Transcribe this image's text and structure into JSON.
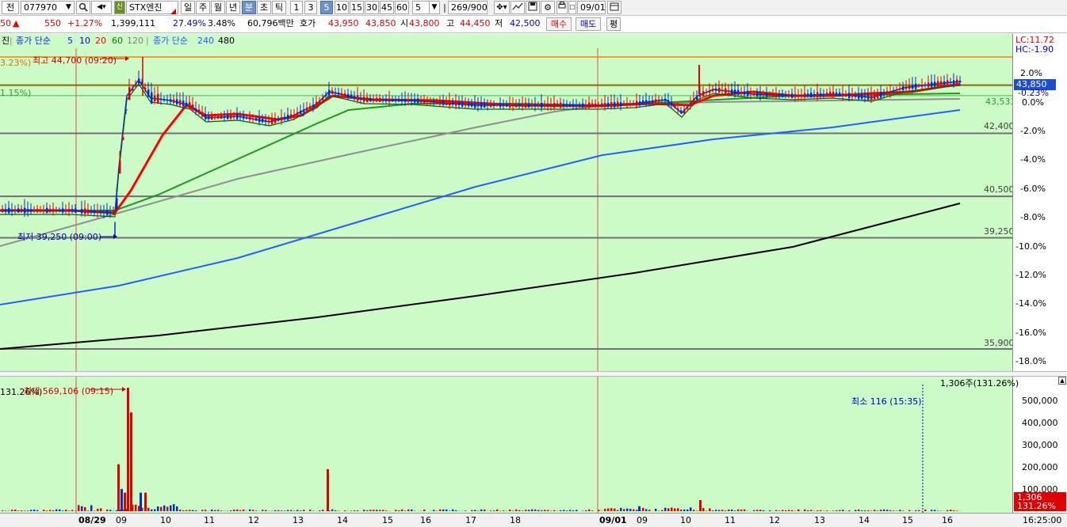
{
  "toolbar": {
    "market_label": "전",
    "code_value": "077970",
    "stock_badge": "신",
    "stock_name": "STX엔진",
    "periods": [
      "일",
      "주",
      "월",
      "년",
      "분",
      "초",
      "틱"
    ],
    "selected_period": "분",
    "intervals": [
      "1",
      "3",
      "5",
      "10",
      "15",
      "30",
      "45",
      "60"
    ],
    "selected_interval": "5",
    "interval_value": "5",
    "count_value": "269/900",
    "date_value": "09/01"
  },
  "info": {
    "price_tail": "50",
    "change_arrow": "▲",
    "change": "550",
    "change_pct": "+1.27%",
    "volume": "1,399,111",
    "vol_ratio": "27.49%",
    "turnover_pct": "3.48%",
    "amount": "60,796백만",
    "quote_label": "호가",
    "ask": "43,950",
    "bid": "43,850",
    "open_label": "시",
    "open": "43,800",
    "high_label": "고",
    "high": "44,450",
    "low_label": "저",
    "low": "42,500",
    "buy_label": "매수",
    "sell_label": "매도",
    "eval_label": "평"
  },
  "legend": {
    "tag": "진",
    "ma_label": "종가 단순",
    "ma_periods": [
      "5",
      "10",
      "20",
      "60",
      "120"
    ],
    "ma_colors": [
      "#1c1cff",
      "#0000cc",
      "#ff0000",
      "#008000",
      "#808080"
    ],
    "long_label": "종가 단순",
    "long_periods": [
      "240",
      "480"
    ],
    "long_colors": [
      "#1e5cff",
      "#000000"
    ]
  },
  "price_chart": {
    "top_left_pct": "3.23%)",
    "high_marker": "최고 44,700 (09:20)",
    "mid_left_pct": "1.15%)",
    "low_marker": "최저 39,250 (09:00)",
    "right_labels": {
      "current": "43,850",
      "ma_value": "43,533",
      "level1": "42,400",
      "level2": "40,500",
      "level3": "39,250",
      "level4": "35,900"
    },
    "axis_top": {
      "lc": "LC:11.72",
      "hc": "HC:-1.90"
    },
    "axis_pcts": [
      "2.0%",
      "-0.23%",
      "0.0%",
      "-2.0%",
      "-4.0%",
      "-6.0%",
      "-8.0%",
      "-10.0%",
      "-12.0%",
      "-14.0%",
      "-16.0%",
      "-18.0%"
    ],
    "current_pct": "-0.23%"
  },
  "volume_chart": {
    "left_pct": "131.26%)",
    "max_marker": "최대 569,106 (09:15)",
    "min_marker": "최소 116 (15:35)",
    "top_right": "1,306주(131.26%)",
    "axis_labels": [
      "500,000",
      "400,000",
      "300,000",
      "200,000",
      "100,000"
    ],
    "current_value": "1,306",
    "current_pct": "131.26%"
  },
  "time_axis": {
    "labels": [
      "08/29",
      "09",
      "10",
      "11",
      "12",
      "13",
      "14",
      "15",
      "16",
      "17",
      "18",
      "09/01",
      "09",
      "10",
      "11",
      "12",
      "13",
      "14",
      "15",
      "16"
    ],
    "clock": "16:25:00"
  },
  "colors": {
    "plot_bg": "#cdfbc8",
    "up": "#e00000",
    "down": "#0030c0"
  },
  "chart_data": {
    "type": "candlestick",
    "x_unit": "5-minute bars, 08/29 09:00 – 09/01 16:00",
    "price_range": [
      35900,
      44700
    ],
    "horizontal_levels": [
      44700,
      43850,
      43533,
      42400,
      40500,
      39250,
      35900
    ],
    "price_series_summary": {
      "day1_start": 39250,
      "day1_high": 44700,
      "day2_close": 43850
    },
    "volume_range": [
      0,
      569106
    ],
    "volume_max": 569106,
    "volume_min": 116
  }
}
